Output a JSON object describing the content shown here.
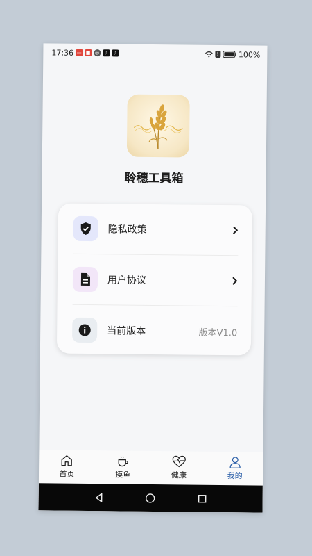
{
  "status_bar": {
    "time": "17:36",
    "battery": "100%"
  },
  "app": {
    "title": "聆穗工具箱",
    "logo_icon": "wheat-logo-icon"
  },
  "menu": {
    "items": [
      {
        "label": "隐私政策",
        "icon": "shield-check-icon",
        "icon_bg": "#e4e7fb",
        "right": ""
      },
      {
        "label": "用户协议",
        "icon": "document-icon",
        "icon_bg": "#f2e6f8",
        "right": ""
      },
      {
        "label": "当前版本",
        "icon": "info-icon",
        "icon_bg": "#e9edf1",
        "right": "版本V1.0"
      }
    ]
  },
  "tabbar": {
    "tabs": [
      {
        "label": "首页",
        "icon": "home-icon"
      },
      {
        "label": "摸鱼",
        "icon": "coffee-cup-icon"
      },
      {
        "label": "健康",
        "icon": "heart-pulse-icon"
      },
      {
        "label": "我的",
        "icon": "person-icon",
        "active": true
      }
    ],
    "active_color": "#2b5fa8"
  }
}
